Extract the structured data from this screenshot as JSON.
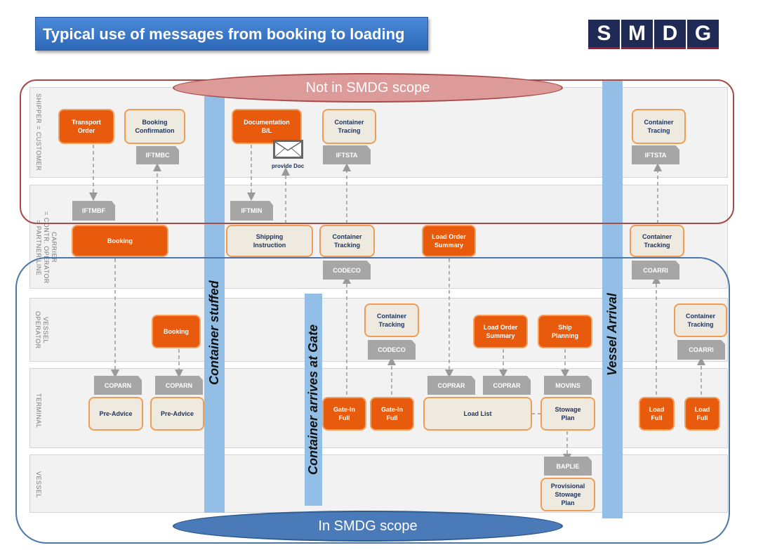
{
  "title": "Typical use of messages from booking to loading",
  "logo": {
    "letters": [
      "S",
      "M",
      "D",
      "G"
    ]
  },
  "scopes": {
    "not_in_scope": "Not in SMDG scope",
    "in_scope": "In SMDG scope"
  },
  "lanes": {
    "shipper": "SHIPPER = CUSTOMER",
    "carrier": "CARRIER\n= CONTR. OPERATOR\n= PARTNER LINE",
    "vessel_operator": "VESSEL\nOPERATOR",
    "terminal": "TERMINAL",
    "vessel": "VESSEL"
  },
  "milestones": {
    "container_stuffed": "Container stuffed",
    "container_gate": "Container arrives at Gate",
    "vessel_arrival": "Vessel Arrival"
  },
  "activities": {
    "transport_order": "Transport\nOrder",
    "booking_confirmation": "Booking\nConfirmation",
    "documentation_bl": "Documentation\nB/L",
    "container_tracing_1": "Container\nTracing",
    "container_tracing_2": "Container\nTracing",
    "booking_carrier": "Booking",
    "shipping_instruction": "Shipping\nInstruction",
    "container_tracking_carrier_1": "Container\nTracking",
    "load_order_summary_carrier": "Load Order\nSummary",
    "container_tracking_carrier_2": "Container\nTracking",
    "booking_vessel_op": "Booking",
    "container_tracking_vo_1": "Container\nTracking",
    "load_order_summary_vo": "Load Order\nSummary",
    "ship_planning": "Ship\nPlanning",
    "container_tracking_vo_2": "Container\nTracking",
    "pre_advice_1": "Pre-Advice",
    "pre_advice_2": "Pre-Advice",
    "gate_in_full_1": "Gate-In\nFull",
    "gate_in_full_2": "Gate-In\nFull",
    "load_list": "Load List",
    "stowage_plan": "Stowage\nPlan",
    "load_full_1": "Load\nFull",
    "load_full_2": "Load\nFull",
    "provisional_stowage_plan": "Provisional\nStowage\nPlan"
  },
  "messages": {
    "iftmbc": "IFTMBC",
    "iftsta_1": "IFTSTA",
    "iftsta_2": "IFTSTA",
    "iftmbf": "IFTMBF",
    "iftmin": "IFTMIN",
    "codeco_1": "CODECO",
    "coarri_1": "COARRI",
    "codeco_2": "CODECO",
    "coarri_2": "COARRI",
    "coparn_1": "COPARN",
    "coparn_2": "COPARN",
    "coprar_1": "COPRAR",
    "coprar_2": "COPRAR",
    "movins": "MOVINS",
    "baplie": "BAPLIE"
  },
  "provide_doc": "provide Doc",
  "colors": {
    "activity": "#e85a0c",
    "document": "#efeae0",
    "document_border": "#ef9d55",
    "message": "#a6a6a6",
    "milestone_bar": "#93bfe6",
    "not_in_scope": "#d98f8f",
    "in_scope": "#4a7ab8"
  }
}
